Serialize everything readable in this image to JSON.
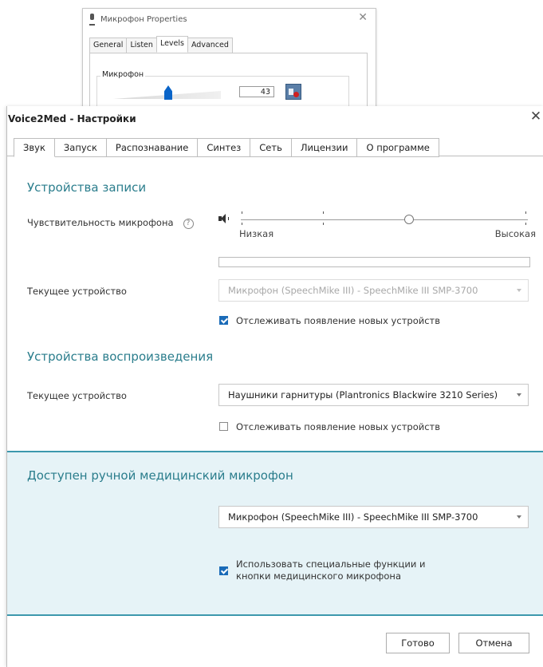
{
  "properties_window": {
    "title": "Микрофон Properties",
    "tabs": [
      "General",
      "Listen",
      "Levels",
      "Advanced"
    ],
    "active_tab": "Levels",
    "group_label": "Микрофон",
    "level_value": "43",
    "level_fraction": 0.43
  },
  "dialog": {
    "title": "Voice2Med - Настройки",
    "close_glyph": "✕",
    "tabs": [
      "Звук",
      "Запуск",
      "Распознавание",
      "Синтез",
      "Сеть",
      "Лицензии",
      "О программе"
    ],
    "active_tab": "Звук"
  },
  "recording": {
    "section_title": "Устройства записи",
    "sensitivity_label": "Чувствительность микрофона",
    "help_glyph": "?",
    "slider_low": "Низкая",
    "slider_high": "Высокая",
    "slider_fraction": 0.6,
    "level_fraction": 0.0,
    "device_label": "Текущее устройство",
    "device_value": "Микрофон (SpeechMike III) - SpeechMike III SMP-3700",
    "device_disabled": true,
    "track_new_label": "Отслеживать появление новых устройств",
    "track_new_checked": true
  },
  "playback": {
    "section_title": "Устройства воспроизведения",
    "device_label": "Текущее устройство",
    "device_value": "Наушники гарнитуры (Plantronics Blackwire 3210 Series)",
    "track_new_label": "Отслеживать появление новых устройств",
    "track_new_checked": false
  },
  "medical": {
    "section_title": "Доступен ручной медицинский микрофон",
    "device_value": "Микрофон (SpeechMike III) - SpeechMike III SMP-3700",
    "use_special_line1": "Использовать специальные функции и",
    "use_special_line2": "кнопки медицинского микрофона",
    "use_special_checked": true
  },
  "footer": {
    "ok_label": "Готово",
    "cancel_label": "Отмена"
  },
  "colors": {
    "accent": "#2a7d8c",
    "panel_bg": "#e6f3f7",
    "panel_border": "#3c98ad",
    "checkbox": "#1a6bb8"
  }
}
